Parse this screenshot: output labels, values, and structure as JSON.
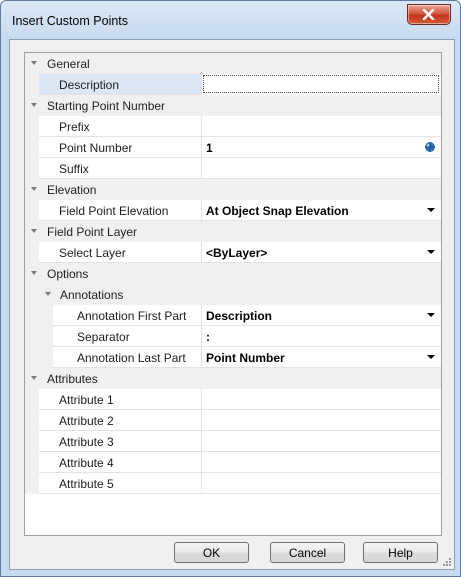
{
  "window": {
    "title": "Insert Custom Points"
  },
  "grid": {
    "categories": {
      "general": "General",
      "starting_point_number": "Starting Point Number",
      "elevation": "Elevation",
      "field_point_layer": "Field Point Layer",
      "options": "Options",
      "annotations": "Annotations",
      "attributes": "Attributes"
    },
    "properties": {
      "description": {
        "name": "Description",
        "value": ""
      },
      "prefix": {
        "name": "Prefix",
        "value": ""
      },
      "point_number": {
        "name": "Point Number",
        "value": "1"
      },
      "suffix": {
        "name": "Suffix",
        "value": ""
      },
      "field_point_elevation": {
        "name": "Field Point Elevation",
        "value": "At Object Snap Elevation"
      },
      "select_layer": {
        "name": "Select Layer",
        "value": "<ByLayer>"
      },
      "annotation_first_part": {
        "name": "Annotation First Part",
        "value": "Description"
      },
      "separator": {
        "name": "Separator",
        "value": ":"
      },
      "annotation_last_part": {
        "name": "Annotation Last Part",
        "value": "Point Number"
      },
      "attribute_1": {
        "name": "Attribute 1",
        "value": ""
      },
      "attribute_2": {
        "name": "Attribute 2",
        "value": ""
      },
      "attribute_3": {
        "name": "Attribute 3",
        "value": ""
      },
      "attribute_4": {
        "name": "Attribute 4",
        "value": ""
      },
      "attribute_5": {
        "name": "Attribute 5",
        "value": ""
      }
    }
  },
  "buttons": {
    "ok": "OK",
    "cancel": "Cancel",
    "help": "Help"
  },
  "colors": {
    "selected_row": "#dce7f5",
    "category_background": "#f0f0f0",
    "close_button": "#c2341c"
  },
  "icons": {
    "close": "close-icon",
    "expander": "chevron-down-icon",
    "pick": "pick-point-icon",
    "dropdown": "dropdown-arrow-icon"
  }
}
